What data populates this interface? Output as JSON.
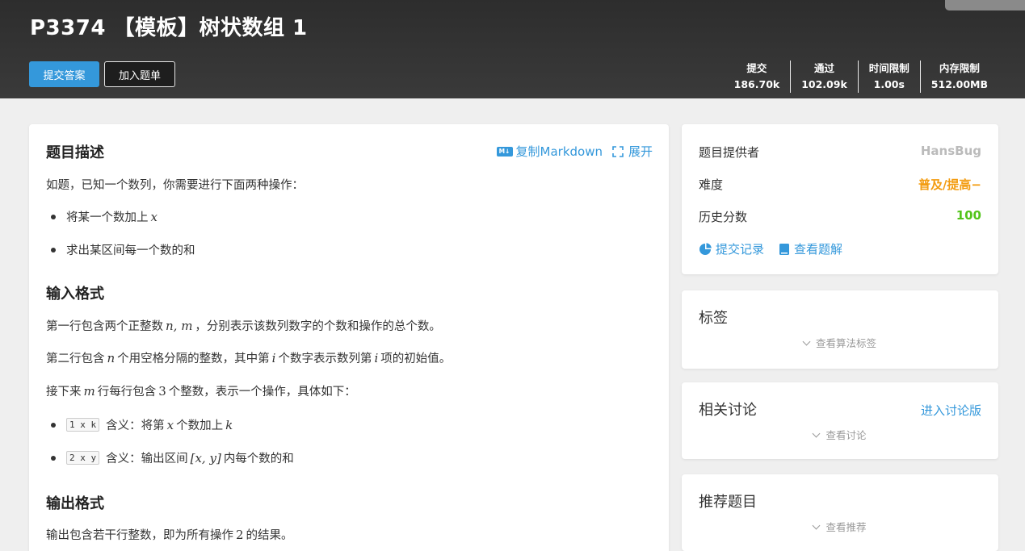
{
  "header": {
    "title": "P3374 【模板】树状数组 1",
    "submit_label": "提交答案",
    "add_label": "加入题单",
    "stats": [
      {
        "label": "提交",
        "value": "186.70k"
      },
      {
        "label": "通过",
        "value": "102.09k"
      },
      {
        "label": "时间限制",
        "value": "1.00s"
      },
      {
        "label": "内存限制",
        "value": "512.00MB"
      }
    ]
  },
  "problem": {
    "desc_title": "题目描述",
    "copy_md_label": "复制Markdown",
    "expand_label": "展开",
    "desc_intro": "如题，已知一个数列，你需要进行下面两种操作：",
    "ops": [
      {
        "text": "将某一个数加上",
        "var": "x"
      },
      {
        "text": "求出某区间每一个数的和"
      }
    ],
    "input_title": "输入格式",
    "input_line1": {
      "pre": "第一行包含两个正整数",
      "math": "n, m",
      "post": "，分别表示该数列数字的个数和操作的总个数。"
    },
    "input_line2": {
      "pre": "第二行包含",
      "m1": "n",
      "mid1": "个用空格分隔的整数，其中第",
      "m2": "i",
      "mid2": "个数字表示数列第",
      "m3": "i",
      "post": "项的初始值。"
    },
    "input_line3": {
      "pre": "接下来",
      "m1": "m",
      "mid1": "行每行包含",
      "m2": "3",
      "post": "个整数，表示一个操作，具体如下："
    },
    "input_ops": [
      {
        "code": "1 x k",
        "pre": "含义：将第",
        "m1": "x",
        "mid": "个数加上",
        "m2": "k"
      },
      {
        "code": "2 x y",
        "pre": "含义：输出区间",
        "m1": "[x, y]",
        "mid": "内每个数的和"
      }
    ],
    "output_title": "输出格式",
    "output_line": {
      "pre": "输出包含若干行整数，即为所有操作",
      "m1": "2",
      "post": "的结果。"
    }
  },
  "sidebar": {
    "provider_label": "题目提供者",
    "provider_value": "HansBug",
    "difficulty_label": "难度",
    "difficulty_value": "普及/提高−",
    "history_label": "历史分数",
    "history_value": "100",
    "records_label": "提交记录",
    "solutions_label": "查看题解",
    "tags_title": "标签",
    "tags_expand": "查看算法标签",
    "discuss_title": "相关讨论",
    "discuss_link": "进入讨论版",
    "discuss_expand": "查看讨论",
    "recommend_title": "推荐题目",
    "recommend_expand": "查看推荐"
  },
  "colors": {
    "accent": "#3498db",
    "difficulty": "#f39c11",
    "score": "#52c41a",
    "provider": "#bbbbbb"
  }
}
